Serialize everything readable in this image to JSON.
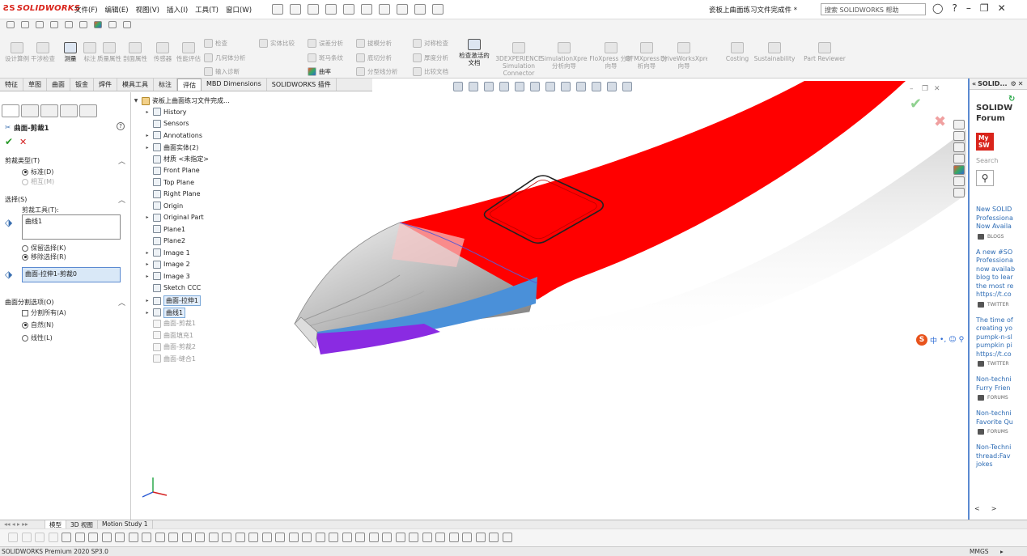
{
  "title_bar": {
    "logo": "SOLIDWORKS",
    "menus": [
      "文件(F)",
      "编辑(E)",
      "视图(V)",
      "插入(I)",
      "工具(T)",
      "窗口(W)"
    ],
    "document_title": "瓷板上曲面练习文件完成件 *",
    "search_placeholder": "搜索 SOLIDWORKS 帮助"
  },
  "command_manager": {
    "large_buttons": [
      {
        "label": "设计算例",
        "enabled": false
      },
      {
        "label": "干涉检查",
        "enabled": false
      },
      {
        "label": "测量",
        "enabled": true
      },
      {
        "label": "标注",
        "enabled": false
      },
      {
        "label": "质量属性",
        "enabled": false
      },
      {
        "label": "剖面属性",
        "enabled": false
      },
      {
        "label": "传感器",
        "enabled": false
      },
      {
        "label": "性能评估",
        "enabled": false
      }
    ],
    "small_buttons": [
      {
        "label": "检查",
        "enabled": false
      },
      {
        "label": "几何体分析",
        "enabled": false
      },
      {
        "label": "输入诊断",
        "enabled": false
      },
      {
        "label": "实体比较",
        "enabled": false
      },
      {
        "label": "误差分析",
        "enabled": false
      },
      {
        "label": "斑马条纹",
        "enabled": false
      },
      {
        "label": "曲率",
        "enabled": true
      },
      {
        "label": "拔模分析",
        "enabled": false
      },
      {
        "label": "底切分析",
        "enabled": false
      },
      {
        "label": "分型线分析",
        "enabled": false
      },
      {
        "label": "对称检查",
        "enabled": false
      },
      {
        "label": "厚度分析",
        "enabled": false
      },
      {
        "label": "比较文档",
        "enabled": false
      }
    ],
    "check_active_doc": "检查激活的文档",
    "addin_buttons": [
      {
        "label": "3DEXPERIENCE Simulation Connector"
      },
      {
        "label": "SimulationXpress 分析向导"
      },
      {
        "label": "FloXpress 分析向导"
      },
      {
        "label": "DFMXpress 分析向导"
      },
      {
        "label": "DriveWorksXpress 向导"
      },
      {
        "label": "Costing"
      },
      {
        "label": "Sustainability"
      },
      {
        "label": "Part Reviewer"
      }
    ]
  },
  "tabs": [
    "特征",
    "草图",
    "曲面",
    "钣金",
    "焊件",
    "模具工具",
    "标注",
    "评估",
    "MBD Dimensions",
    "SOLIDWORKS 插件"
  ],
  "active_tab": "评估",
  "property_manager": {
    "title": "曲面-剪裁1",
    "sections": {
      "trim_type": {
        "header": "剪裁类型(T)",
        "options": [
          {
            "label": "标准(D)",
            "checked": true,
            "enabled": true
          },
          {
            "label": "相互(M)",
            "checked": false,
            "enabled": false
          }
        ]
      },
      "selections": {
        "header": "选择(S)",
        "trim_tool_label": "剪裁工具(T):",
        "trim_tool_value": "曲线1",
        "keep_remove": [
          {
            "label": "保留选择(K)",
            "checked": false
          },
          {
            "label": "移除选择(R)",
            "checked": true
          }
        ],
        "pieces_value": "曲面-拉伸1-剪裁0"
      },
      "split_options": {
        "header": "曲面分割选项(O)",
        "split_all": "分割所有(A)",
        "options": [
          {
            "label": "自然(N)",
            "checked": true
          },
          {
            "label": "线性(L)",
            "checked": false
          }
        ]
      }
    }
  },
  "feature_tree": {
    "root": "瓷板上曲面练习文件完成...",
    "nodes": [
      {
        "label": "History",
        "arrow": true,
        "grey": false
      },
      {
        "label": "Sensors",
        "arrow": false,
        "grey": false
      },
      {
        "label": "Annotations",
        "arrow": true,
        "grey": false
      },
      {
        "label": "曲面实体(2)",
        "arrow": true,
        "grey": false
      },
      {
        "label": "材质 <未指定>",
        "arrow": false,
        "grey": false
      },
      {
        "label": "Front Plane",
        "arrow": false,
        "grey": false
      },
      {
        "label": "Top Plane",
        "arrow": false,
        "grey": false
      },
      {
        "label": "Right Plane",
        "arrow": false,
        "grey": false
      },
      {
        "label": "Origin",
        "arrow": false,
        "grey": false
      },
      {
        "label": "Original Part",
        "arrow": true,
        "grey": false
      },
      {
        "label": "Plane1",
        "arrow": false,
        "grey": false
      },
      {
        "label": "Plane2",
        "arrow": false,
        "grey": false
      },
      {
        "label": "Image 1",
        "arrow": true,
        "grey": false
      },
      {
        "label": "Image 2",
        "arrow": true,
        "grey": false
      },
      {
        "label": "Image 3",
        "arrow": true,
        "grey": false
      },
      {
        "label": "Sketch CCC",
        "arrow": false,
        "grey": false
      },
      {
        "label": "曲面-拉伸1",
        "arrow": true,
        "grey": false,
        "selected": true
      },
      {
        "label": "曲线1",
        "arrow": true,
        "grey": false,
        "selected": true
      },
      {
        "label": "曲面-剪裁1",
        "arrow": false,
        "grey": true
      },
      {
        "label": "曲面填充1",
        "arrow": false,
        "grey": true
      },
      {
        "label": "曲面-剪裁2",
        "arrow": false,
        "grey": true
      },
      {
        "label": "曲面-缝合1",
        "arrow": false,
        "grey": true
      }
    ]
  },
  "task_pane": {
    "header": "SOLID...",
    "forum_title_1": "SOLIDW",
    "forum_title_2": "Forum",
    "mysw_1": "My",
    "mysw_2": "SW",
    "search_placeholder": "Search",
    "feed": [
      {
        "lines": [
          "New SOLID",
          "Professiona",
          "Now Availa"
        ],
        "tag": "BLOGS"
      },
      {
        "lines": [
          "A new #SO",
          "Professiona",
          "now availab",
          "blog to lear",
          "the most re",
          "https://t.co"
        ],
        "tag": "TWITTER"
      },
      {
        "lines": [
          "The time of",
          "creating yo",
          "pumpk-n-sl",
          "pumpkin pi",
          "https://t.co"
        ],
        "tag": "TWITTER"
      },
      {
        "lines": [
          "Non-techni",
          "Furry Frien"
        ],
        "tag": "FORUMS"
      },
      {
        "lines": [
          "Non-techni",
          "Favorite Qu"
        ],
        "tag": "FORUMS"
      },
      {
        "lines": [
          "Non-Techni",
          "thread:Fav",
          "jokes"
        ],
        "tag": ""
      }
    ]
  },
  "ime": {
    "label": "中"
  },
  "bottom_tabs": [
    "模型",
    "3D 视图",
    "Motion Study 1"
  ],
  "active_bottom_tab": "模型",
  "status_bar": {
    "left": "SOLIDWORKS Premium 2020 SP3.0",
    "right": "MMGS"
  },
  "colors": {
    "surface_red": "#ff0000",
    "trim_blue": "#4a90d9",
    "trim_purple": "#8a2be2",
    "pane_border": "#5b8ad1"
  }
}
